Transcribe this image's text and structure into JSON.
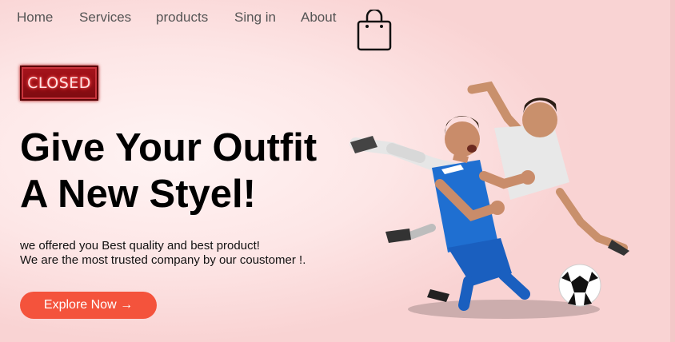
{
  "nav": {
    "items": [
      "Home",
      "Services",
      "products",
      "Sing in",
      "About"
    ],
    "cart_icon": "shopping-bag-icon"
  },
  "hero": {
    "sign_text": "CLOSED",
    "title_line1": "Give Your Outfit",
    "title_line2": "A New Styel!",
    "desc_line1": "we offered you Best quality and best product!",
    "desc_line2": "We are the most trusted company by our coustomer !.",
    "cta_label": "Explore Now →",
    "image": "soccer-players-photo"
  },
  "colors": {
    "cta": "#f4533c",
    "sign": "#a8141c",
    "kit_blue": "#1f6fd1",
    "kit_white": "#e8e8e8"
  }
}
